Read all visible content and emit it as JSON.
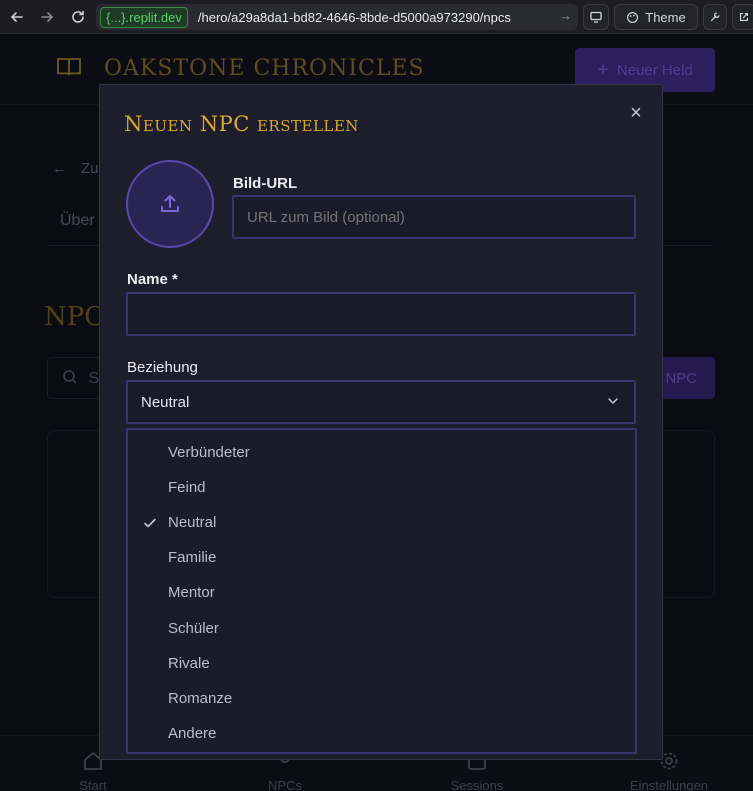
{
  "browser": {
    "url_domain": "{...}.replit.dev",
    "url_path": "/hero/a29a8da1-bd82-4646-8bde-d5000a973290/npcs",
    "theme_label": "Theme"
  },
  "app": {
    "brand_title": "OAKSTONE CHRONICLES",
    "new_hero_label": "Neuer Held",
    "back_label": "Zu",
    "tab_overview_label": "Über",
    "npcs_title": "NPC",
    "search_label": "S",
    "add_npc_label": "NPC"
  },
  "bottom_nav": {
    "items": [
      {
        "label": "Start",
        "icon": "home-icon"
      },
      {
        "label": "NPCs",
        "icon": "users-icon"
      },
      {
        "label": "Sessions",
        "icon": "calendar-icon"
      },
      {
        "label": "Einstellungen",
        "icon": "settings-icon"
      }
    ]
  },
  "modal": {
    "title": "Neuen NPC erstellen",
    "image_url_label": "Bild-URL",
    "image_url_placeholder": "URL zum Bild (optional)",
    "name_label": "Name *",
    "name_value": "",
    "relationship_label": "Beziehung",
    "relationship_selected": "Neutral",
    "relationship_options": [
      "Verbündeter",
      "Feind",
      "Neutral",
      "Familie",
      "Mentor",
      "Schüler",
      "Rivale",
      "Romanze",
      "Andere"
    ]
  },
  "colors": {
    "accent_gold": "#d9a830",
    "accent_purple": "#5a48a8",
    "modal_bg": "#1d1d2b"
  }
}
